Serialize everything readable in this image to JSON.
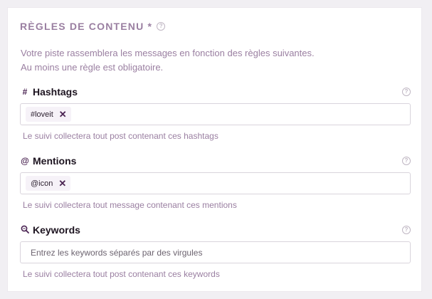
{
  "header": {
    "title": "RÈGLES DE CONTENU *",
    "help_icon": "question-circle-icon"
  },
  "description": {
    "line1": "Votre piste rassemblera les messages en fonction des règles suivantes.",
    "line2": "Au moins une règle est obligatoire."
  },
  "colors": {
    "accent": "#9a7fa1",
    "tag_bg": "#f6f2f8",
    "icon_dark": "#4a2352"
  },
  "sections": {
    "hashtags": {
      "icon_glyph": "#",
      "icon_name": "hashtag-icon",
      "label": "Hashtags",
      "tags": [
        "#loveit"
      ],
      "hint": "Le suivi collectera tout post contenant ces hashtags"
    },
    "mentions": {
      "icon_glyph": "@",
      "icon_name": "at-icon",
      "label": "Mentions",
      "tags": [
        "@icon"
      ],
      "hint": "Le suivi collectera tout message contenant ces mentions"
    },
    "keywords": {
      "icon_glyph": "🔍",
      "icon_name": "keyword-search-icon",
      "label": "Keywords",
      "placeholder": "Entrez les keywords séparés par des virgules",
      "value": "",
      "hint": "Le suivi collectera tout post contenant ces keywords"
    }
  }
}
